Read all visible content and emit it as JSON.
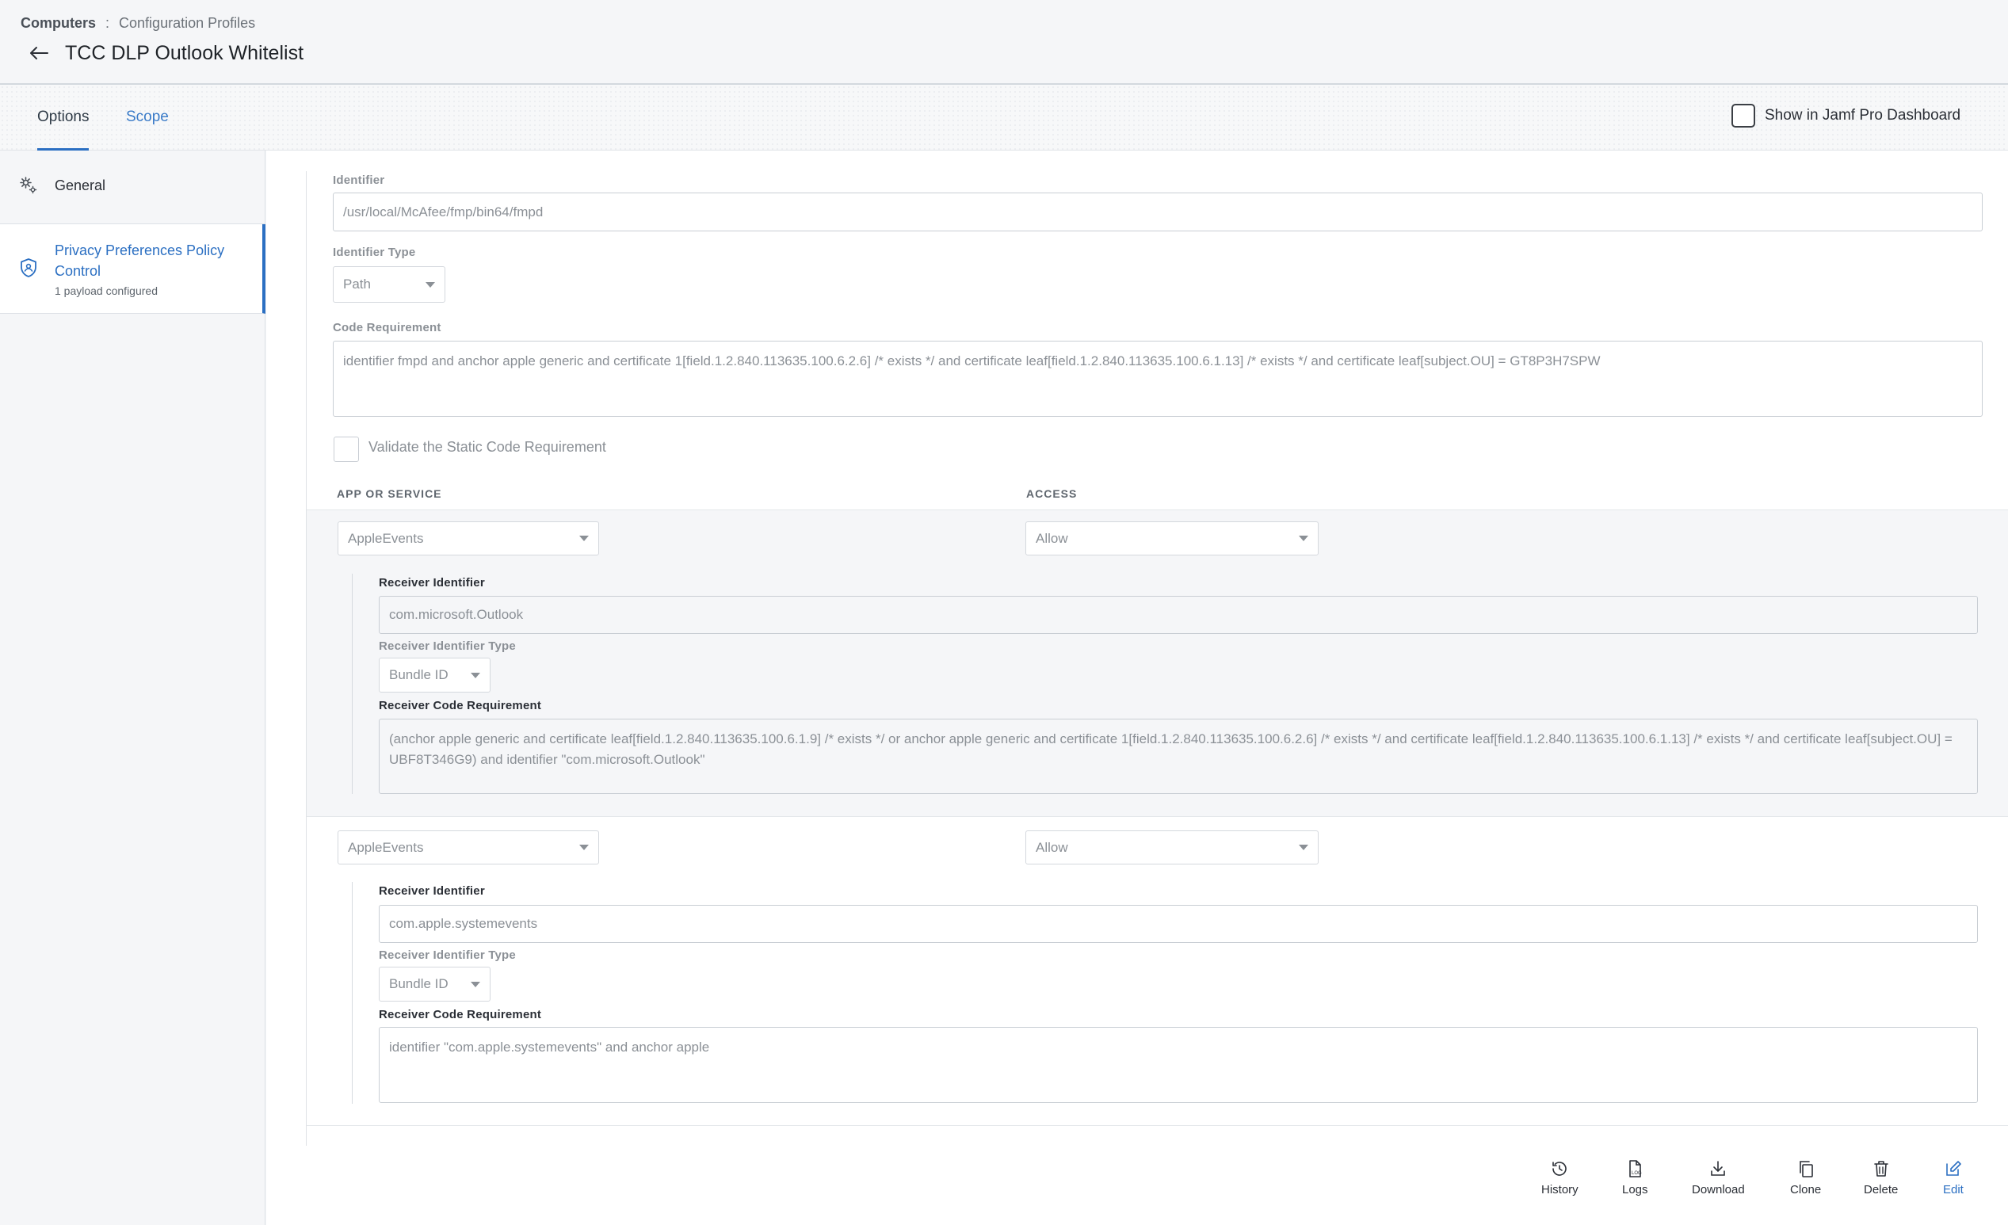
{
  "breadcrumb": {
    "root": "Computers",
    "separator": ":",
    "current": "Configuration Profiles"
  },
  "page": {
    "title": "TCC DLP Outlook Whitelist"
  },
  "tabs": {
    "options": "Options",
    "scope": "Scope"
  },
  "dashboard": {
    "label": "Show in Jamf Pro Dashboard"
  },
  "sidebar": {
    "general": "General",
    "ppc": {
      "label": "Privacy Preferences Policy Control",
      "sub": "1 payload configured"
    }
  },
  "form": {
    "identifier_label": "Identifier",
    "identifier_value": "/usr/local/McAfee/fmp/bin64/fmpd",
    "identifier_type_label": "Identifier Type",
    "identifier_type_value": "Path",
    "code_req_label": "Code Requirement",
    "code_req_value": "identifier fmpd and anchor apple generic and certificate 1[field.1.2.840.113635.100.6.2.6] /* exists */ and certificate leaf[field.1.2.840.113635.100.6.1.13] /* exists */ and certificate leaf[subject.OU] = GT8P3H7SPW",
    "validate_label": "Validate the Static Code Requirement",
    "col_app": "APP OR SERVICE",
    "col_access": "ACCESS"
  },
  "rules": [
    {
      "service": "AppleEvents",
      "access": "Allow",
      "receiver_id_label": "Receiver Identifier",
      "receiver_id": "com.microsoft.Outlook",
      "receiver_type_label": "Receiver Identifier Type",
      "receiver_type": "Bundle ID",
      "receiver_code_label": "Receiver Code Requirement",
      "receiver_code": "(anchor apple generic and certificate leaf[field.1.2.840.113635.100.6.1.9] /* exists */ or anchor apple generic and certificate 1[field.1.2.840.113635.100.6.2.6] /* exists */ and certificate leaf[field.1.2.840.113635.100.6.1.13] /* exists */ and certificate leaf[subject.OU] = UBF8T346G9) and identifier \"com.microsoft.Outlook\""
    },
    {
      "service": "AppleEvents",
      "access": "Allow",
      "receiver_id_label": "Receiver Identifier",
      "receiver_id": "com.apple.systemevents",
      "receiver_type_label": "Receiver Identifier Type",
      "receiver_type": "Bundle ID",
      "receiver_code_label": "Receiver Code Requirement",
      "receiver_code": "identifier \"com.apple.systemevents\" and anchor apple"
    }
  ],
  "toolbar": {
    "history": "History",
    "logs": "Logs",
    "download": "Download",
    "clone": "Clone",
    "delete": "Delete",
    "edit": "Edit"
  },
  "colors": {
    "accent": "#2b6fc2",
    "muted_text": "#8b9096",
    "shaded_bg": "#f5f6f8"
  }
}
